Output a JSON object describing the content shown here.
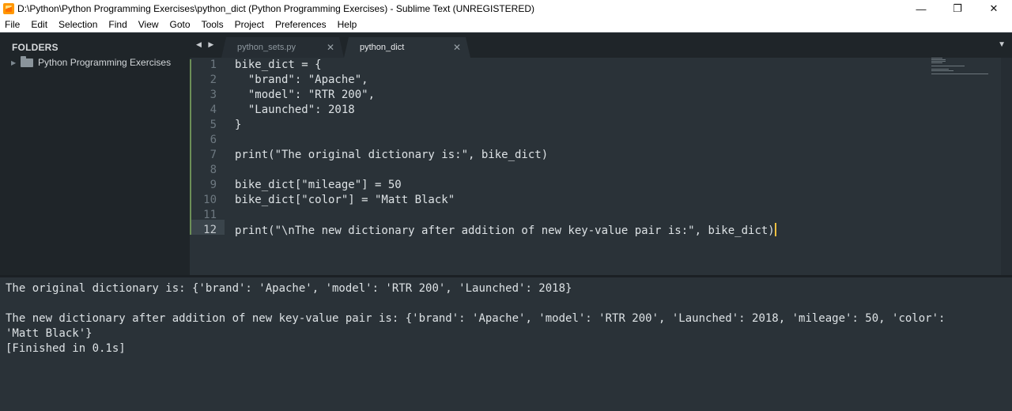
{
  "window": {
    "title": "D:\\Python\\Python Programming Exercises\\python_dict (Python Programming Exercises) - Sublime Text (UNREGISTERED)",
    "app_icon": "sublime-text-icon",
    "controls": {
      "minimize": "—",
      "restore": "❐",
      "close": "✕"
    }
  },
  "menu": [
    "File",
    "Edit",
    "Selection",
    "Find",
    "View",
    "Goto",
    "Tools",
    "Project",
    "Preferences",
    "Help"
  ],
  "sidebar": {
    "header": "FOLDERS",
    "folders": [
      {
        "label": "Python Programming Exercises",
        "expanded": false
      }
    ]
  },
  "tabs": {
    "nav": "◀ ▶",
    "dropdown": "▼",
    "items": [
      {
        "label": "python_sets.py",
        "active": false,
        "close": "✕"
      },
      {
        "label": "python_dict",
        "active": true,
        "close": "✕"
      }
    ]
  },
  "editor": {
    "current_line": 12,
    "line_numbers": [
      "1",
      "2",
      "3",
      "4",
      "5",
      "6",
      "7",
      "8",
      "9",
      "10",
      "11",
      "12"
    ],
    "lines": [
      "bike_dict = {",
      "  \"brand\": \"Apache\",",
      "  \"model\": \"RTR 200\",",
      "  \"Launched\": 2018",
      "}",
      "",
      "print(\"The original dictionary is:\", bike_dict)",
      "",
      "bike_dict[\"mileage\"] = 50",
      "bike_dict[\"color\"] = \"Matt Black\"",
      "",
      "print(\"\\nThe new dictionary after addition of new key-value pair is:\", bike_dict)"
    ]
  },
  "output": {
    "lines": [
      "The original dictionary is: {'brand': 'Apache', 'model': 'RTR 200', 'Launched': 2018}",
      "",
      "The new dictionary after addition of new key-value pair is: {'brand': 'Apache', 'model': 'RTR 200', 'Launched': 2018, 'mileage': 50, 'color':",
      "'Matt Black'}",
      "[Finished in 0.1s]"
    ]
  },
  "colors": {
    "editor_bg": "#2a3238",
    "sidebar_bg": "#1f2529",
    "text": "#dde2e5",
    "line_number": "#6d7880",
    "modified_marker": "#6c8f57",
    "cursor": "#f0c040"
  }
}
